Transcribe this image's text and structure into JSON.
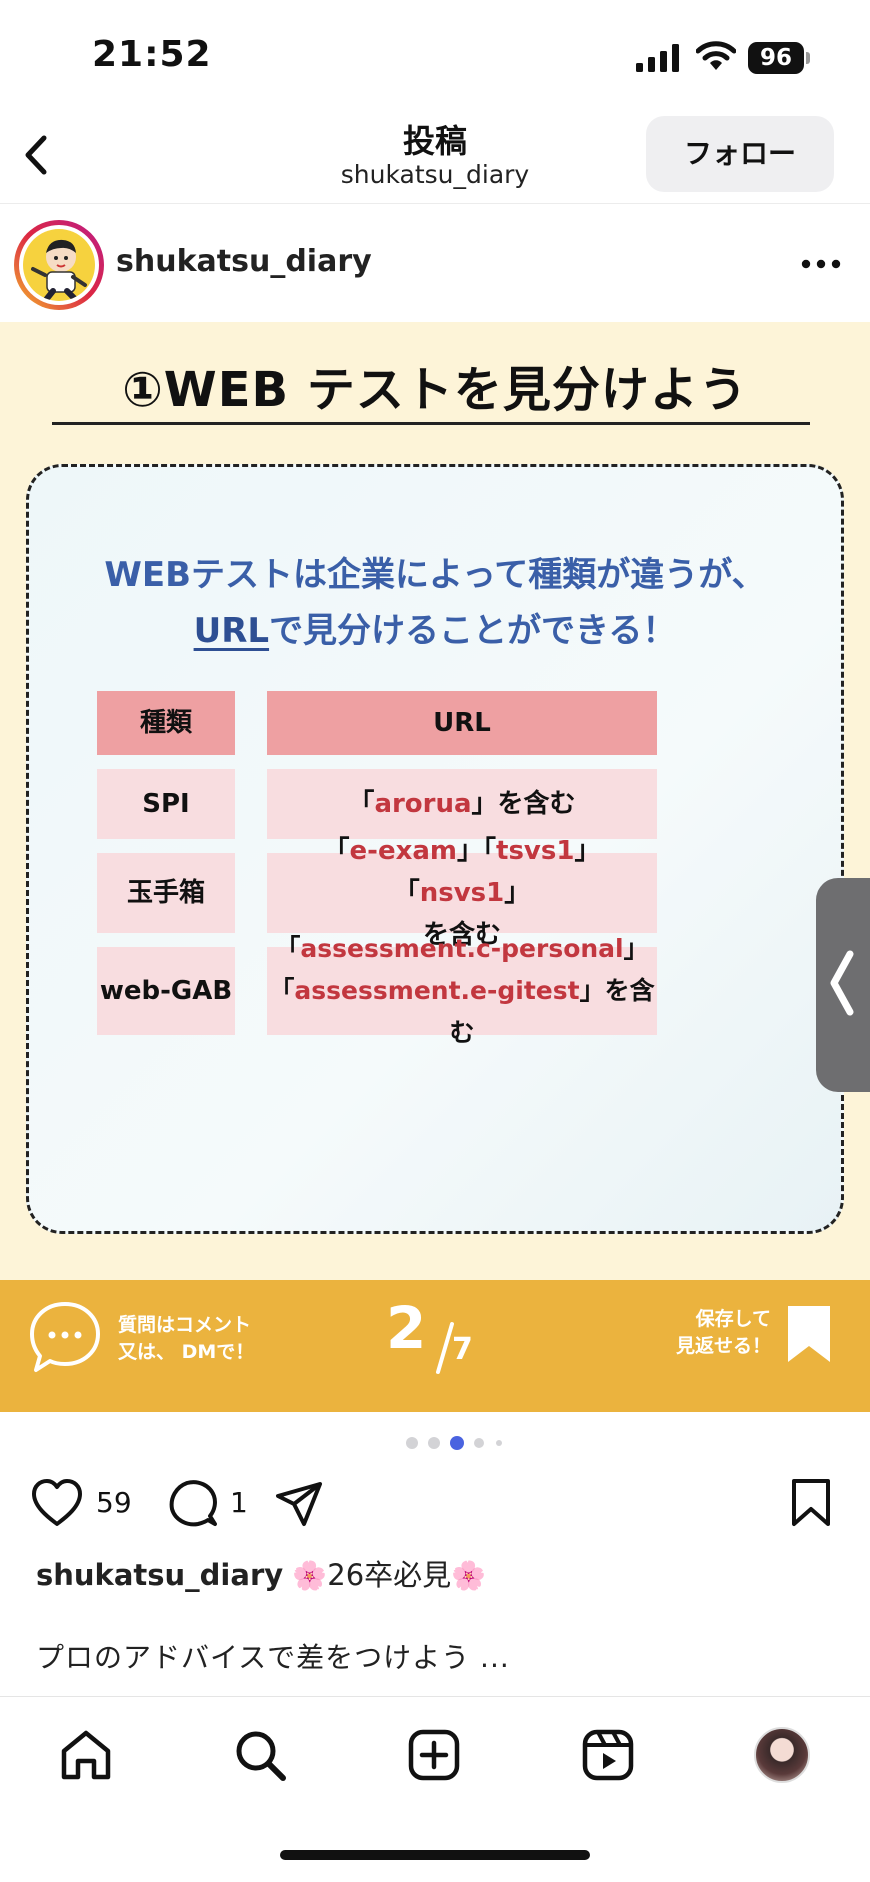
{
  "status_bar": {
    "time": "21:52",
    "battery": "96"
  },
  "header": {
    "title": "投稿",
    "subtitle": "shukatsu_diary",
    "follow_label": "フォロー"
  },
  "post": {
    "username": "shukatsu_diary"
  },
  "slide": {
    "title": "①WEB テストを見分けよう",
    "headline_line1": "WEBテストは企業によって種類が違うが、",
    "headline_link": "URL",
    "headline_line2_rest": "で見分けることができる！",
    "table": {
      "headers": [
        "種類",
        "URL"
      ],
      "rows": [
        {
          "type": "SPI",
          "url_parts": [
            "「",
            "arorua",
            "」を含む"
          ]
        },
        {
          "type": "玉手箱",
          "url_line1": [
            "「",
            "e-exam",
            "」「",
            "tsvs1",
            "」「",
            "nsvs1",
            "」"
          ],
          "url_line2": "を含む"
        },
        {
          "type": "web-GAB",
          "url_line1": [
            "「",
            "assessment.c-personal",
            "」"
          ],
          "url_line2": [
            "「",
            "assessment.e-gitest",
            "」を含む"
          ]
        }
      ]
    },
    "band": {
      "left_line1": "質問はコメント",
      "left_line2": "又は、 DMで！",
      "page_current": "2",
      "page_total": "7",
      "right_line1": "保存して",
      "right_line2": "見返せる！"
    },
    "carousel": {
      "index": 3,
      "count": 5
    }
  },
  "actions": {
    "likes": "59",
    "comments": "1"
  },
  "caption": {
    "username": "shukatsu_diary",
    "flower": "🌸",
    "tag": "26卒必見",
    "text": "プロのアドバイスで差をつけよう ..."
  },
  "colors": {
    "accent_blue": "#3a5fa8",
    "band_yellow": "#ebb33e",
    "table_head": "#eea0a2",
    "table_body": "#f8dde0",
    "highlight_red": "#c2373f",
    "active_dot": "#4a63e0"
  },
  "icons": [
    "back-icon",
    "more-icon",
    "comment-bubble-icon",
    "bookmark-icon",
    "heart-icon",
    "comment-icon",
    "share-icon",
    "home-icon",
    "search-icon",
    "create-icon",
    "reels-icon"
  ]
}
